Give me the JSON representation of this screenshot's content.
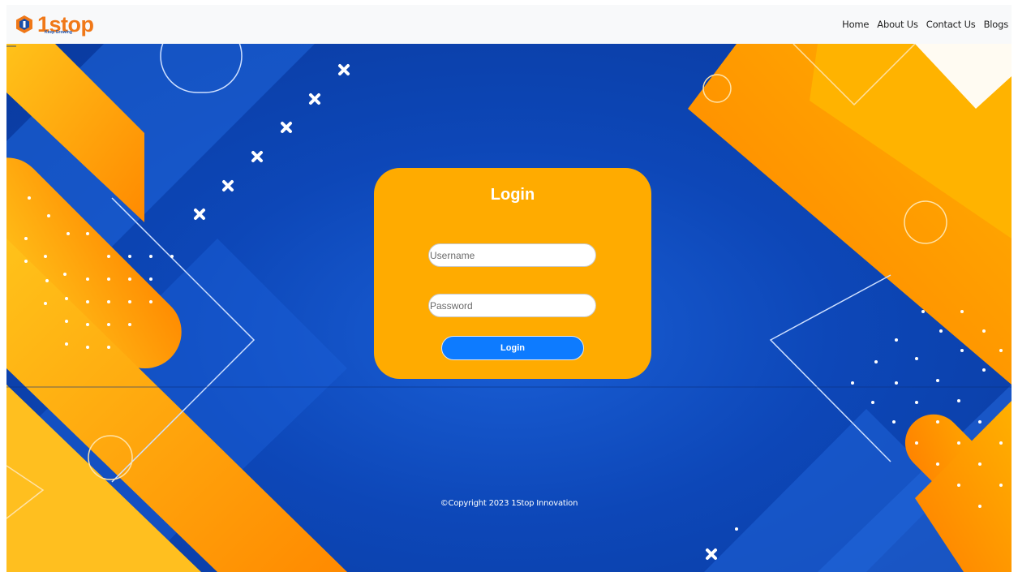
{
  "brand": {
    "name": "1stop",
    "tagline": "Keep Growing",
    "logo_icon": "hexagon-logo-icon",
    "primary_color": "#f07818",
    "secondary_color": "#1a4fa8"
  },
  "nav": {
    "items": [
      {
        "label": "Home"
      },
      {
        "label": "About Us"
      },
      {
        "label": "Contact Us"
      },
      {
        "label": "Blogs"
      }
    ]
  },
  "login": {
    "title": "Login",
    "username": {
      "placeholder": "Username",
      "value": ""
    },
    "password": {
      "placeholder": "Password",
      "value": ""
    },
    "submit_label": "Login",
    "card_color": "#ffab00",
    "button_color": "#0d7bff"
  },
  "footer": {
    "copyright": "©Copyright 2023 1Stop Innovation"
  }
}
